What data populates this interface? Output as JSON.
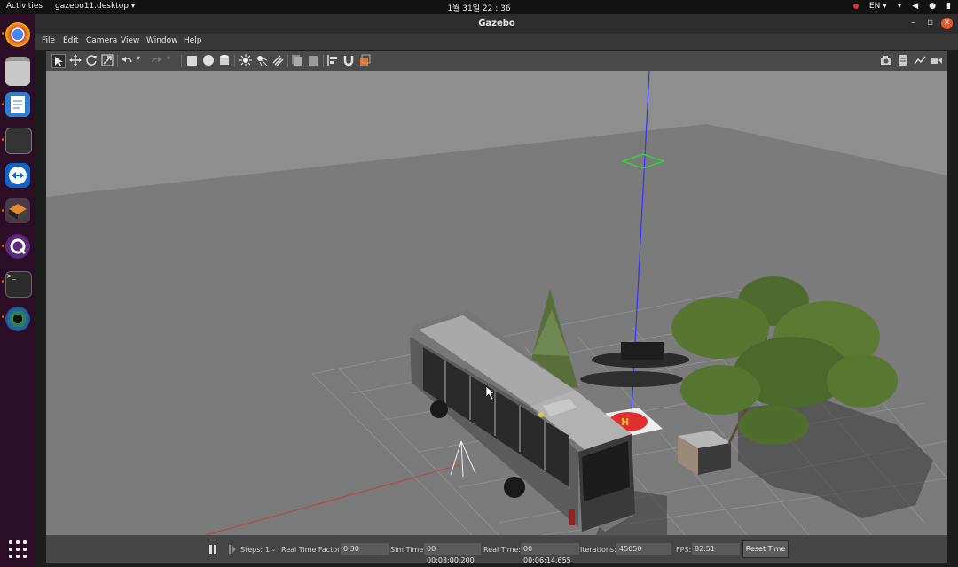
{
  "topbar": {
    "activities": "Activities",
    "app_menu": "gazebo11.desktop ▾",
    "clock": "1월 31일  22 : 36",
    "lang": "EN ▾",
    "tray_icons": [
      "record-indicator-icon",
      "wifi-icon",
      "volume-icon",
      "mic-icon",
      "battery-icon"
    ]
  },
  "dock": {
    "apps": [
      "chrome",
      "files",
      "libreoffice-writer",
      "system-monitor",
      "teamviewer",
      "gazebo",
      "qgroundcontrol",
      "terminal",
      "camera-app"
    ],
    "show_apps_icon": "grid-icon"
  },
  "window": {
    "title": "Gazebo",
    "minimize": "–",
    "restore": "▫",
    "close": "✕"
  },
  "menu": {
    "file": "File",
    "edit": "Edit",
    "camera": "Camera",
    "view": "View",
    "window": "Window",
    "help": "Help"
  },
  "toolbar": {
    "tools": [
      "select-arrow",
      "translate",
      "rotate",
      "scale",
      "undo",
      "redo",
      "box",
      "sphere",
      "cylinder",
      "point-light",
      "spot-light",
      "directional-light",
      "copy",
      "paste",
      "align",
      "snap",
      "change-view"
    ],
    "right_tools": [
      "screenshot",
      "log",
      "plot",
      "video"
    ]
  },
  "statusbar": {
    "pause_icon": "pause-icon",
    "step_icon": "step-icon",
    "steps_label": "Steps:",
    "steps_value": "1",
    "rtf_label": "Real Time Factor:",
    "rtf_value": "0.30",
    "sim_time_label": "Sim Time:",
    "sim_time_value": "00 00:03:00.200",
    "real_time_label": "Real Time:",
    "real_time_value": "00 00:06:14.655",
    "iterations_label": "Iterations:",
    "iterations_value": "45050",
    "fps_label": "FPS:",
    "fps_value": "82.51",
    "reset_label": "Reset Time"
  },
  "colors": {
    "viewport_bg": "#8c8c8c",
    "ground": "#7c7c7c",
    "z_axis": "#3a3aff",
    "x_axis": "#d04040",
    "accent": "#e2552b"
  }
}
